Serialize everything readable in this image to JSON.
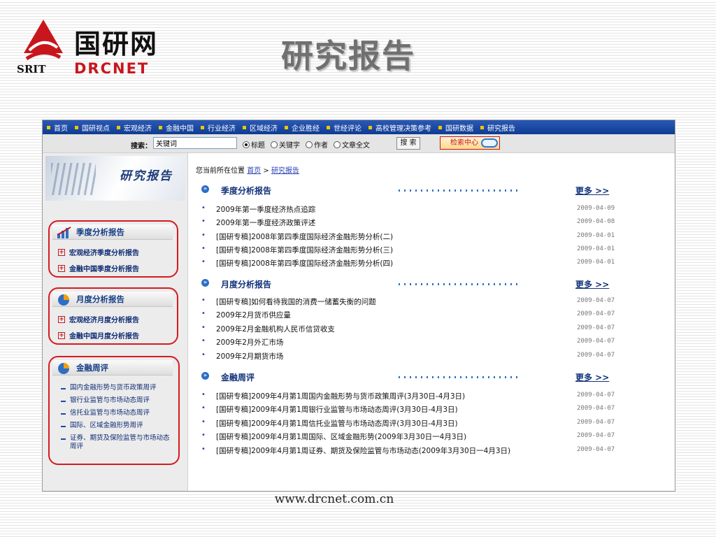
{
  "logo": {
    "cn": "国研网",
    "en": "DRCNET",
    "srit": "SRIT"
  },
  "slide_title": "研究报告",
  "footer_url": "www.drcnet.com.cn",
  "nav": [
    "首页",
    "国研视点",
    "宏观经济",
    "金融中国",
    "行业经济",
    "区域经济",
    "企业胜经",
    "世经评论",
    "高校管理决策参考",
    "国研数据",
    "研究报告"
  ],
  "search": {
    "label": "搜索：",
    "value": "关键词",
    "options": [
      {
        "label": "标题",
        "selected": true
      },
      {
        "label": "关键字",
        "selected": false
      },
      {
        "label": "作者",
        "selected": false
      },
      {
        "label": "文章全文",
        "selected": false
      }
    ],
    "button": "搜 索",
    "center_button": "检索中心"
  },
  "sidebar": {
    "banner_title": "研究报告",
    "quarterly": {
      "title": "季度分析报告",
      "items": [
        "宏观经济季度分析报告",
        "金融中国季度分析报告"
      ]
    },
    "monthly": {
      "title": "月度分析报告",
      "items": [
        "宏观经济月度分析报告",
        "金融中国月度分析报告"
      ]
    },
    "weekly": {
      "title": "金融周评",
      "items": [
        "国内金融形势与货币政策周评",
        "银行业监管与市场动态周评",
        "信托业监管与市场动态周评",
        "国际、区域金融形势周评",
        "证券、期货及保险监管与市场动态周评"
      ]
    }
  },
  "breadcrumb": {
    "prefix": "您当前所在位置",
    "home": "首页",
    "sep": ">",
    "current": "研究报告"
  },
  "sections": [
    {
      "title": "季度分析报告",
      "more": "更多 >>",
      "items": [
        {
          "title": "2009年第一季度经济热点追踪",
          "date": "2009-04-09"
        },
        {
          "title": "2009年第一季度经济政策评述",
          "date": "2009-04-08"
        },
        {
          "title": "[国研专稿]2008年第四季度国际经济金融形势分析(二)",
          "date": "2009-04-01"
        },
        {
          "title": "[国研专稿]2008年第四季度国际经济金融形势分析(三)",
          "date": "2009-04-01"
        },
        {
          "title": "[国研专稿]2008年第四季度国际经济金融形势分析(四)",
          "date": "2009-04-01"
        }
      ]
    },
    {
      "title": "月度分析报告",
      "more": "更多 >>",
      "items": [
        {
          "title": "[国研专稿]如何看待我国的消费一储蓄失衡的问题",
          "date": "2009-04-07"
        },
        {
          "title": "2009年2月货币供应量",
          "date": "2009-04-07"
        },
        {
          "title": "2009年2月金融机构人民币信贷收支",
          "date": "2009-04-07"
        },
        {
          "title": "2009年2月外汇市场",
          "date": "2009-04-07"
        },
        {
          "title": "2009年2月期货市场",
          "date": "2009-04-07"
        }
      ]
    },
    {
      "title": "金融周评",
      "more": "更多 >>",
      "items": [
        {
          "title": "[国研专稿]2009年4月第1周国内金融形势与货币政策周评(3月30日-4月3日)",
          "date": "2009-04-07"
        },
        {
          "title": "[国研专稿]2009年4月第1周银行业监管与市场动态周评(3月30日-4月3日)",
          "date": "2009-04-07"
        },
        {
          "title": "[国研专稿]2009年4月第1周信托业监管与市场动态周评(3月30日-4月3日)",
          "date": "2009-04-07"
        },
        {
          "title": "[国研专稿]2009年4月第1周国际、区域金融形势(2009年3月30日一4月3日)",
          "date": "2009-04-07"
        },
        {
          "title": "[国研专稿]2009年4月第1周证券、期货及保险监管与市场动态(2009年3月30日一4月3日)",
          "date": "2009-04-07"
        }
      ]
    }
  ]
}
